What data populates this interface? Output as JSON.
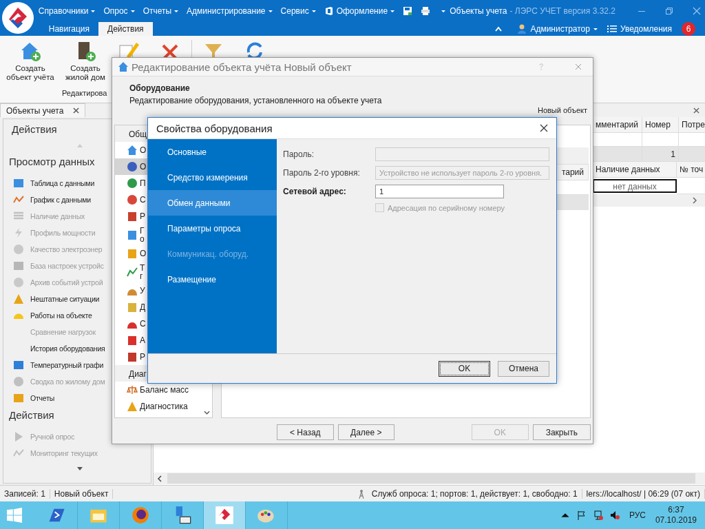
{
  "app": {
    "menu": [
      {
        "label": "Справочники",
        "kind": "menu"
      },
      {
        "label": "Опрос",
        "kind": "menu"
      },
      {
        "label": "Отчеты",
        "kind": "menu"
      },
      {
        "label": "Администрирование",
        "kind": "menu"
      },
      {
        "label": "Сервис",
        "kind": "menu"
      },
      {
        "label": "Оформление",
        "kind": "office"
      }
    ],
    "title": "Объекты учета",
    "subtitle": "- ЛЭРС УЧЕТ версия 3.32.2",
    "tabs": [
      {
        "label": "Навигация",
        "selected": false
      },
      {
        "label": "Действия",
        "selected": true
      }
    ],
    "user": "Администратор",
    "notifications": {
      "label": "Уведомления",
      "count": "6"
    }
  },
  "ribbon": {
    "buttons": [
      "Создать объект учёта",
      "Создать жилой дом"
    ],
    "group_label": "Редактирова"
  },
  "left_panel": {
    "tab": "Объекты учета",
    "title": "Действия",
    "groups": [
      {
        "title": "Просмотр данных",
        "items": [
          {
            "label": "Таблица с данными",
            "disabled": false
          },
          {
            "label": "График с данными",
            "disabled": false
          },
          {
            "label": "Наличие данных",
            "disabled": true
          },
          {
            "label": "Профиль мощности",
            "disabled": true
          },
          {
            "label": "Качество электроэнер",
            "disabled": true
          },
          {
            "label": "База настроек устройс",
            "disabled": true
          },
          {
            "label": "Архив событий устрой",
            "disabled": true
          },
          {
            "label": "Нештатные ситуации",
            "disabled": false
          },
          {
            "label": "Работы на объекте",
            "disabled": false
          },
          {
            "label": "Сравнение нагрузок",
            "disabled": true
          },
          {
            "label": "История оборудования",
            "disabled": false
          },
          {
            "label": "Температурный графи",
            "disabled": false
          },
          {
            "label": "Сводка по жилому дом",
            "disabled": true
          },
          {
            "label": "Отчеты",
            "disabled": false
          }
        ]
      },
      {
        "title": "Действия",
        "items": [
          {
            "label": "Ручной опрос",
            "disabled": true
          },
          {
            "label": "Мониторинг текущих",
            "disabled": true
          }
        ]
      }
    ]
  },
  "grid": {
    "columns": [
      "мментарий",
      "Номер",
      "Потре"
    ],
    "group_value": "1",
    "detail_columns": [
      "Наличие данных",
      "№ точ"
    ],
    "detail_cell": "нет данных"
  },
  "edit_dialog": {
    "title": "Редактирование объекта учёта Новый объект",
    "section_title": "Оборудование",
    "description": "Редактирование оборудования, установленного на объекте учета",
    "object_name": "Новый объект",
    "groups": [
      {
        "title": "Общ",
        "items": [
          {
            "label": "О",
            "selected": false
          },
          {
            "label": "О",
            "selected": true
          },
          {
            "label": "П",
            "selected": false
          },
          {
            "label": "С",
            "selected": false
          },
          {
            "label": "Р",
            "selected": false
          },
          {
            "label": "Г\nо",
            "selected": false
          },
          {
            "label": "О",
            "selected": false
          },
          {
            "label": "Т\nг",
            "selected": false
          },
          {
            "label": "У",
            "selected": false
          },
          {
            "label": "Д",
            "selected": false
          },
          {
            "label": "С",
            "selected": false
          },
          {
            "label": "А",
            "selected": false
          },
          {
            "label": "Р",
            "selected": false
          }
        ]
      },
      {
        "title": "Диаг",
        "items": [
          {
            "label": "Баланс масс",
            "selected": false
          },
          {
            "label": "Диагностика",
            "selected": false
          }
        ]
      }
    ],
    "pane_column": "тарий",
    "buttons": [
      {
        "label": "< Назад",
        "disabled": false
      },
      {
        "label": "Далее >",
        "disabled": false
      },
      {
        "label": "OK",
        "disabled": true
      },
      {
        "label": "Закрыть",
        "disabled": false
      }
    ]
  },
  "props_dialog": {
    "title": "Свойства оборудования",
    "nav": [
      {
        "label": "Основные",
        "selected": false,
        "disabled": false
      },
      {
        "label": "Средство измерения",
        "selected": false,
        "disabled": false
      },
      {
        "label": "Обмен данными",
        "selected": true,
        "disabled": false
      },
      {
        "label": "Параметры опроса",
        "selected": false,
        "disabled": false
      },
      {
        "label": "Коммуникац. оборуд.",
        "selected": false,
        "disabled": true
      },
      {
        "label": "Размещение",
        "selected": false,
        "disabled": false
      }
    ],
    "fields": [
      {
        "label": "Пароль:",
        "disabled": true,
        "emphasized": false
      },
      {
        "label": "Пароль 2-го уровня:",
        "value": "Устройство не использует пароль 2-го уровня.",
        "disabled": true,
        "emphasized": false
      },
      {
        "label": "Сетевой адрес:",
        "value": "1",
        "disabled": false,
        "emphasized": true
      }
    ],
    "checkbox": {
      "label": "Адресация по серийному номеру",
      "checked": false,
      "disabled": true
    },
    "buttons": [
      {
        "label": "OK",
        "focused": true
      },
      {
        "label": "Отмена",
        "focused": false
      }
    ]
  },
  "status_bar": {
    "left": [
      "Записей: 1",
      "Новый объект"
    ],
    "services": "Служб опроса: 1; портов: 1, действует: 1, свободно: 1",
    "server": "lers://localhost/ | 06:29 (07 окт)"
  },
  "taskbar": {
    "apps": [
      {
        "selected": false
      },
      {
        "selected": false
      },
      {
        "selected": false
      },
      {
        "selected": false
      },
      {
        "selected": true
      },
      {
        "selected": false
      }
    ],
    "language": "РУС",
    "time": "6:37",
    "date": "07.10.2019"
  }
}
